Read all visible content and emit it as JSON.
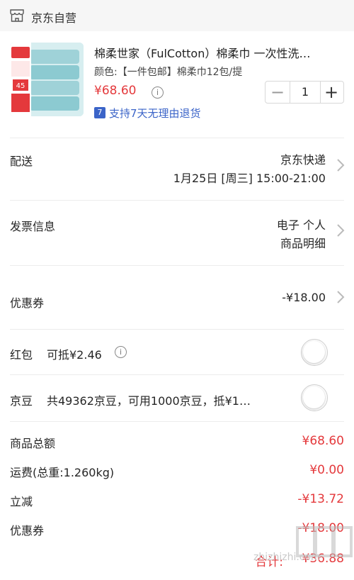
{
  "header": {
    "shop_name": "京东自营",
    "shop_icon": "store-icon"
  },
  "product": {
    "title": "棉柔世家（FulCotton）棉柔巾 一次性洗…",
    "spec": "颜色:【一件包邮】棉柔巾12包/提",
    "price": "¥68.60",
    "quantity": "1",
    "return_badge": "7",
    "return_policy": "支持7天无理由退货",
    "thumb_label": "45"
  },
  "delivery": {
    "label": "配送",
    "carrier": "京东快递",
    "time": "1月25日 [周三] 15:00-21:00"
  },
  "invoice": {
    "label": "发票信息",
    "type": "电子 个人",
    "content": "商品明细"
  },
  "coupon": {
    "label": "优惠券",
    "value": "-¥18.00"
  },
  "redpacket": {
    "label": "红包",
    "note": "可抵¥2.46",
    "enabled": false
  },
  "jingdou": {
    "label": "京豆",
    "note": "共49362京豆，可用1000京豆，抵¥1…",
    "enabled": false
  },
  "summary": {
    "goods_total_label": "商品总额",
    "goods_total": "¥68.60",
    "shipping_label": "运费(总重:1.260kg)",
    "shipping": "¥0.00",
    "discount_label": "立减",
    "discount": "-¥13.72",
    "coupon_label": "优惠券",
    "coupon": "-¥18.00",
    "total_label": "合计:",
    "total": "¥36.88"
  },
  "watermark": {
    "text": "zhizhizhi.com",
    "logo": "值值值"
  },
  "colors": {
    "price_red": "#e4393c",
    "link_blue": "#3b64c8"
  }
}
